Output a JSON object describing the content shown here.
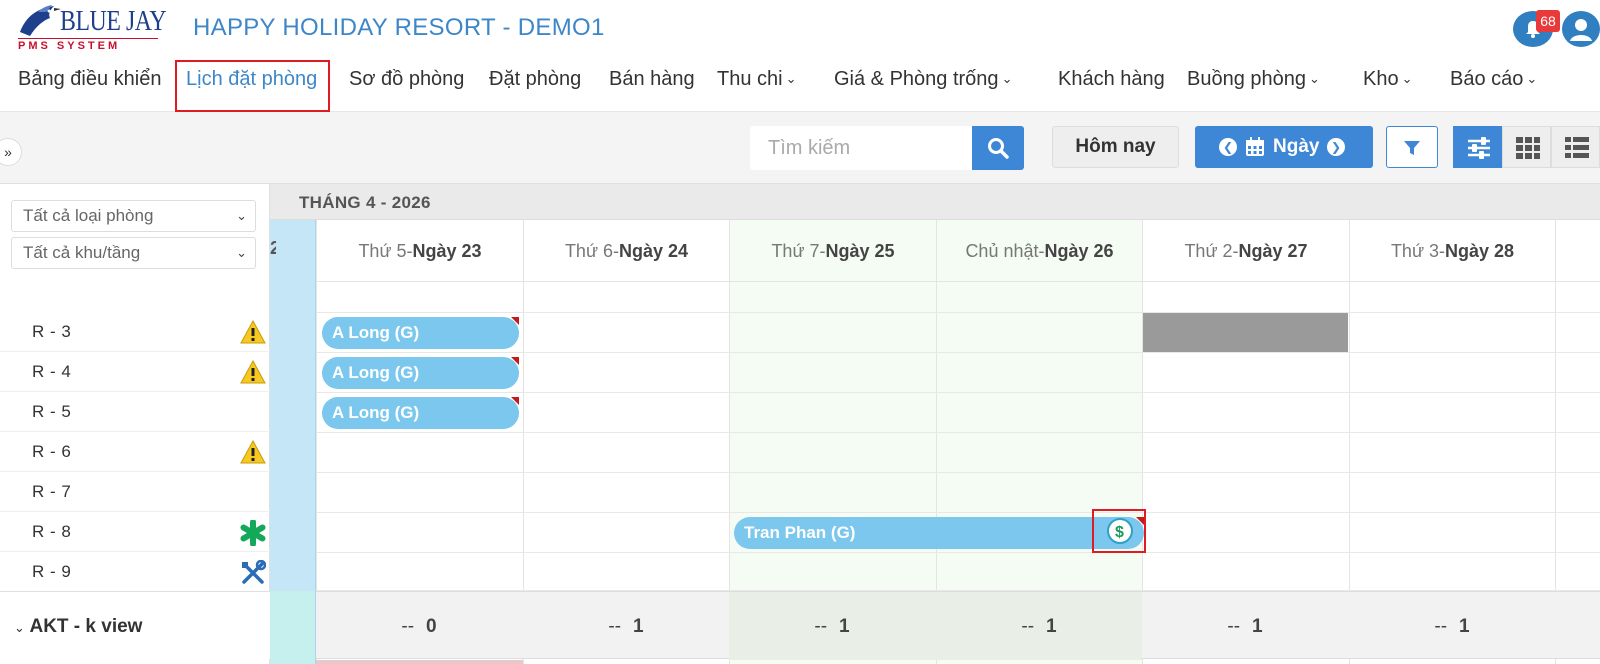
{
  "brand": {
    "logo_text": "BLUE JAY",
    "logo_sub": "PMS SYSTEM",
    "resort_name": "HAPPY HOLIDAY RESORT - DEMO1"
  },
  "notifications": {
    "count": "68"
  },
  "nav": {
    "items": [
      {
        "label": "Bảng điều khiển"
      },
      {
        "label": "Lịch đặt phòng"
      },
      {
        "label": "Sơ đồ phòng"
      },
      {
        "label": "Đặt phòng"
      },
      {
        "label": "Bán hàng"
      },
      {
        "label": "Thu chi"
      },
      {
        "label": "Giá & Phòng trống"
      },
      {
        "label": "Khách hàng"
      },
      {
        "label": "Buồng phòng"
      },
      {
        "label": "Kho"
      },
      {
        "label": "Báo cáo"
      }
    ]
  },
  "toolbar": {
    "expand_label": "»",
    "search_placeholder": "Tìm kiếm",
    "today_label": "Hôm nay",
    "date_mode_label": "Ngày"
  },
  "filters": {
    "room_type": "Tất cả loại phòng",
    "area_floor": "Tất cả khu/tầng"
  },
  "calendar": {
    "month_label": "THÁNG 4 - 2026",
    "partial_day_num": "2",
    "days": [
      {
        "weekday": "Thứ 5-",
        "date": "Ngày 23"
      },
      {
        "weekday": "Thứ 6-",
        "date": "Ngày 24"
      },
      {
        "weekday": "Thứ 7-",
        "date": "Ngày 25"
      },
      {
        "weekday": "Chủ nhật-",
        "date": "Ngày 26"
      },
      {
        "weekday": "Thứ 2-",
        "date": "Ngày 27"
      },
      {
        "weekday": "Thứ 3-",
        "date": "Ngày 28"
      }
    ]
  },
  "rooms": [
    {
      "name": "R - 3",
      "icon": "warning-icon"
    },
    {
      "name": "R - 4",
      "icon": "warning-icon"
    },
    {
      "name": "R - 5",
      "icon": ""
    },
    {
      "name": "R - 6",
      "icon": "warning-icon"
    },
    {
      "name": "R - 7",
      "icon": ""
    },
    {
      "name": "R - 8",
      "icon": "asterisk-icon"
    },
    {
      "name": "R - 9",
      "icon": "wrench-icon"
    }
  ],
  "bookings": [
    {
      "guest": "A Long (G)",
      "room": "R - 3"
    },
    {
      "guest": "A Long (G)",
      "room": "R - 4"
    },
    {
      "guest": "A Long (G)",
      "room": "R - 5"
    },
    {
      "guest": "Tran Phan (G)",
      "room": "R - 8"
    }
  ],
  "group": {
    "label": "AKT - k view",
    "dash": "--",
    "counts": [
      "0",
      "1",
      "1",
      "1",
      "1",
      "1"
    ]
  },
  "colors": {
    "accent": "#3d87d6",
    "booking": "#7bc7ee",
    "today_strip": "#c4e6f6",
    "blocked": "#9a9a9a",
    "highlight_box": "#e01b24"
  }
}
